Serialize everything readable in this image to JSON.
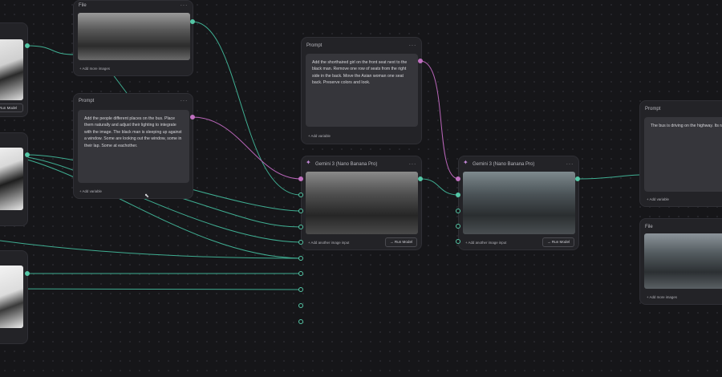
{
  "colors": {
    "canvas": "#161619",
    "node": "#232327",
    "wire_text": "#55c7a6",
    "wire_image": "#c070c0"
  },
  "nodes": {
    "file_top": {
      "title": "File",
      "menu": "···",
      "add_more": "+ Add more images"
    },
    "portrait_1": {
      "button": "Run Model"
    },
    "prompt_1": {
      "title": "Prompt",
      "menu": "···",
      "text": "Add the people different places on the bus. Place them naturally and adjust their lighting to integrate with the image. The black man is sleeping up against a window. Some are looking out the window, some in their lap. Some at eachother.",
      "add_variable": "+ Add variable"
    },
    "prompt_2": {
      "title": "Prompt",
      "menu": "···",
      "text": "Add the shorthaired girl on the front seat next to the black man. Remove one row of seats from the right side in the back. Move the Asian woman one seat back. Preserve colors and look.",
      "add_variable": "+ Add variable"
    },
    "gemini_1": {
      "title": "Gemini 3 (Nano Banana Pro)",
      "menu": "···",
      "add_input": "+ Add another image input",
      "run": "→ Run Model"
    },
    "gemini_2": {
      "title": "Gemini 3 (Nano Banana Pro)",
      "menu": "···",
      "add_input": "+ Add another image input",
      "run": "→ Run Model"
    },
    "prompt_3": {
      "title": "Prompt",
      "text": "The bus is driving on the highway. Its raining. The camera is handheld in a f shot, but shaking from the vibrations The people just are. Subtle movemen of a head. The women in fur smiles to The teenager in fron is fidgeting with",
      "add_variable": "+ Add variable"
    },
    "file_right": {
      "title": "File",
      "add_more": "+ Add more images"
    }
  },
  "icons": {
    "sparkle": "sparkle-icon",
    "cursor": "pointer-cursor-icon"
  }
}
